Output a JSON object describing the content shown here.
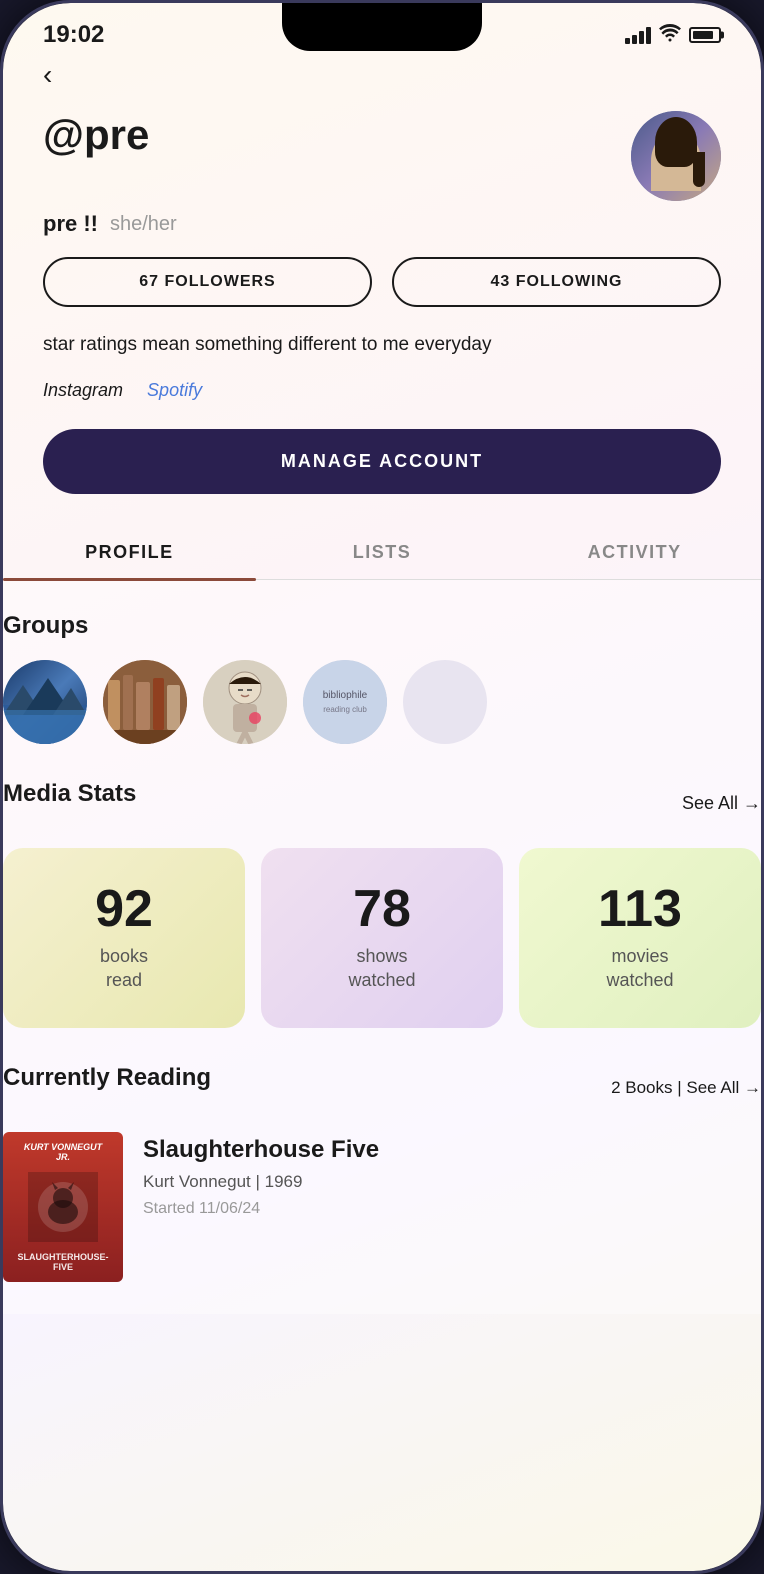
{
  "status_bar": {
    "time": "19:02",
    "signal_label": "signal",
    "wifi_label": "wifi",
    "battery_label": "battery"
  },
  "back_button": {
    "label": "‹"
  },
  "profile": {
    "username": "@pre",
    "display_name": "pre !!",
    "pronouns": "she/her",
    "followers_label": "67 FOLLOWERS",
    "following_label": "43 FOLLOWING",
    "bio": "star ratings mean something different to me everyday",
    "link_instagram": "Instagram",
    "link_spotify": "Spotify",
    "manage_account_label": "MANAGE ACCOUNT"
  },
  "tabs": {
    "profile": "PROFILE",
    "lists": "LISTS",
    "activity": "ACTIVITY"
  },
  "groups": {
    "title": "Groups",
    "items": [
      {
        "id": "group-1",
        "label": "Nature group"
      },
      {
        "id": "group-2",
        "label": "Books group"
      },
      {
        "id": "group-3",
        "label": "Anime group"
      },
      {
        "id": "group-4",
        "label": "Bibliophile group"
      },
      {
        "id": "group-5",
        "label": "Empty group"
      }
    ]
  },
  "media_stats": {
    "title": "Media Stats",
    "see_all": "See All →",
    "books": {
      "number": "92",
      "label": "books\nread"
    },
    "shows": {
      "number": "78",
      "label": "shows\nwatched"
    },
    "movies": {
      "number": "113",
      "label": "movies\nwatched"
    }
  },
  "currently_reading": {
    "title": "Currently Reading",
    "count_link": "2 Books | See All →",
    "book": {
      "title": "Slaughterhouse Five",
      "author_year": "Kurt Vonnegut | 1969",
      "started": "Started 11/06/24"
    }
  }
}
